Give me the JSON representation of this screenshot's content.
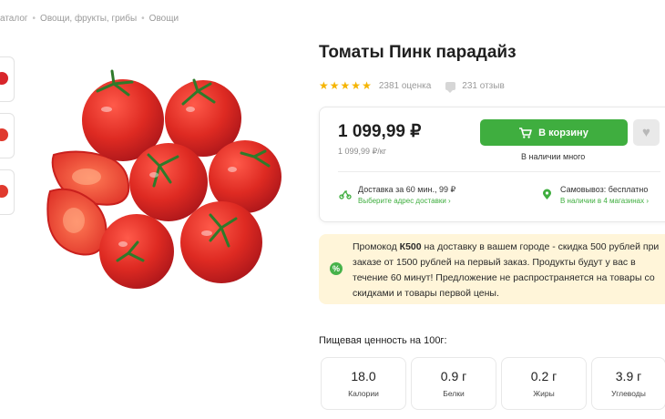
{
  "breadcrumb": {
    "items": [
      "аталог",
      "Овощи, фрукты, грибы",
      "Овощи"
    ],
    "separator": "•"
  },
  "product": {
    "title": "Томаты Пинк парадайз",
    "rating_text": "2381 оценка",
    "reviews_text": "231 отзыв",
    "stars": 5,
    "price": "1 099,99 ₽",
    "unit_price": "1 099,99 ₽/кг",
    "cart_button": "В корзину",
    "stock": "В наличии много"
  },
  "delivery": {
    "title": "Доставка за 60 мин., 99 ₽",
    "link": "Выберите адрес доставки ›"
  },
  "pickup": {
    "title": "Самовывоз: бесплатно",
    "link": "В наличии в 4 магазинах ›"
  },
  "promo": {
    "before_code": "Промокод ",
    "code": "К500",
    "after_code": " на доставку в вашем городе - скидка 500 рублей при заказе от 1500 рублей на первый заказ. Продукты будут у вас в течение 60 минут! Предложение не распространяется на товары со скидками и товары первой цены."
  },
  "nutrition": {
    "title": "Пищевая ценность на 100г:",
    "items": [
      {
        "value": "18.0",
        "label": "Калории"
      },
      {
        "value": "0.9 г",
        "label": "Белки"
      },
      {
        "value": "0.2 г",
        "label": "Жиры"
      },
      {
        "value": "3.9 г",
        "label": "Углеводы"
      }
    ]
  },
  "colors": {
    "accent": "#3fae3f",
    "star": "#f5b400",
    "promo_bg": "#fff5d9",
    "tomato": "#d8252b"
  },
  "icons": {
    "cart": "cart-icon",
    "favorite": "heart-icon",
    "delivery": "scooter-icon",
    "pickup": "location-pin-icon",
    "promo": "percent-icon",
    "reviews": "comment-icon"
  }
}
